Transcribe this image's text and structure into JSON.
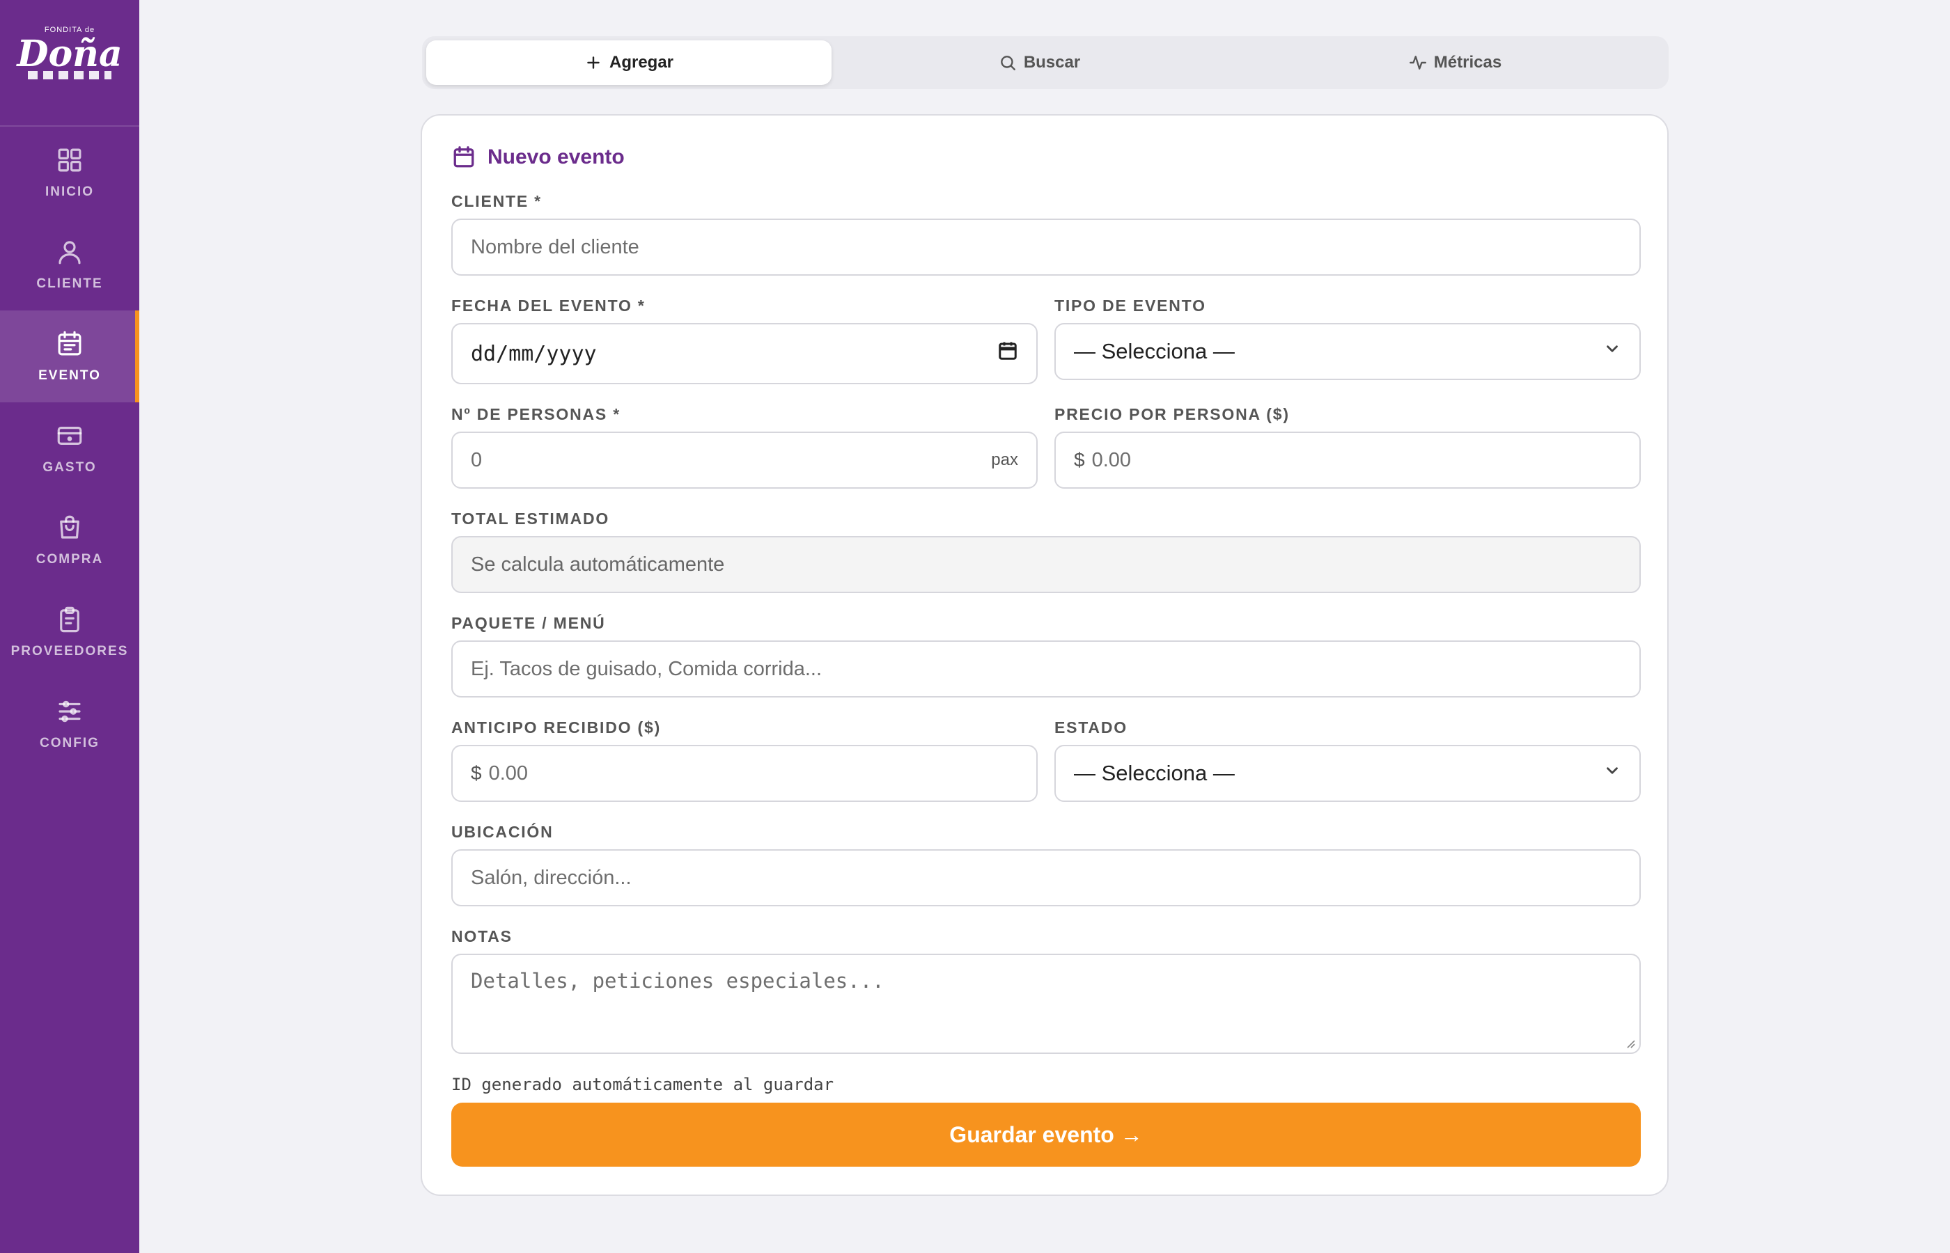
{
  "brand": {
    "small": "FONDITA de",
    "name": "Doña"
  },
  "sidebar": {
    "items": [
      {
        "label": "INICIO",
        "icon": "grid-icon"
      },
      {
        "label": "CLIENTE",
        "icon": "user-icon"
      },
      {
        "label": "EVENTO",
        "icon": "calendar-icon",
        "active": true
      },
      {
        "label": "GASTO",
        "icon": "card-icon"
      },
      {
        "label": "COMPRA",
        "icon": "bag-icon"
      },
      {
        "label": "PROVEEDORES",
        "icon": "clipboard-icon"
      },
      {
        "label": "CONFIG",
        "icon": "sliders-icon"
      }
    ]
  },
  "tabs": [
    {
      "label": "Agregar",
      "icon": "plus-icon",
      "active": true
    },
    {
      "label": "Buscar",
      "icon": "search-icon"
    },
    {
      "label": "Métricas",
      "icon": "activity-icon"
    }
  ],
  "form": {
    "title": "Nuevo evento",
    "cliente": {
      "label": "CLIENTE *",
      "placeholder": "Nombre del cliente"
    },
    "fecha": {
      "label": "FECHA DEL EVENTO *",
      "value": "dd/mm/yyyy"
    },
    "tipo": {
      "label": "TIPO DE EVENTO",
      "value": "— Selecciona —"
    },
    "personas": {
      "label": "Nº DE PERSONAS *",
      "placeholder": "0",
      "suffix": "pax"
    },
    "precio": {
      "label": "PRECIO POR PERSONA ($)",
      "prefix": "$",
      "placeholder": "0.00"
    },
    "total": {
      "label": "TOTAL ESTIMADO",
      "placeholder": "Se calcula automáticamente"
    },
    "paquete": {
      "label": "PAQUETE / MENÚ",
      "placeholder": "Ej. Tacos de guisado, Comida corrida..."
    },
    "anticipo": {
      "label": "ANTICIPO RECIBIDO ($)",
      "prefix": "$",
      "placeholder": "0.00"
    },
    "estado": {
      "label": "ESTADO",
      "value": "— Selecciona —"
    },
    "ubicacion": {
      "label": "UBICACIÓN",
      "placeholder": "Salón, dirección..."
    },
    "notas": {
      "label": "NOTAS",
      "placeholder": "Detalles, peticiones especiales..."
    },
    "id_note": "ID generado automáticamente al guardar",
    "save_label": "Guardar evento →"
  },
  "colors": {
    "sidebar": "#6b2c8c",
    "accent": "#f7931e",
    "title": "#6b2c8c"
  }
}
